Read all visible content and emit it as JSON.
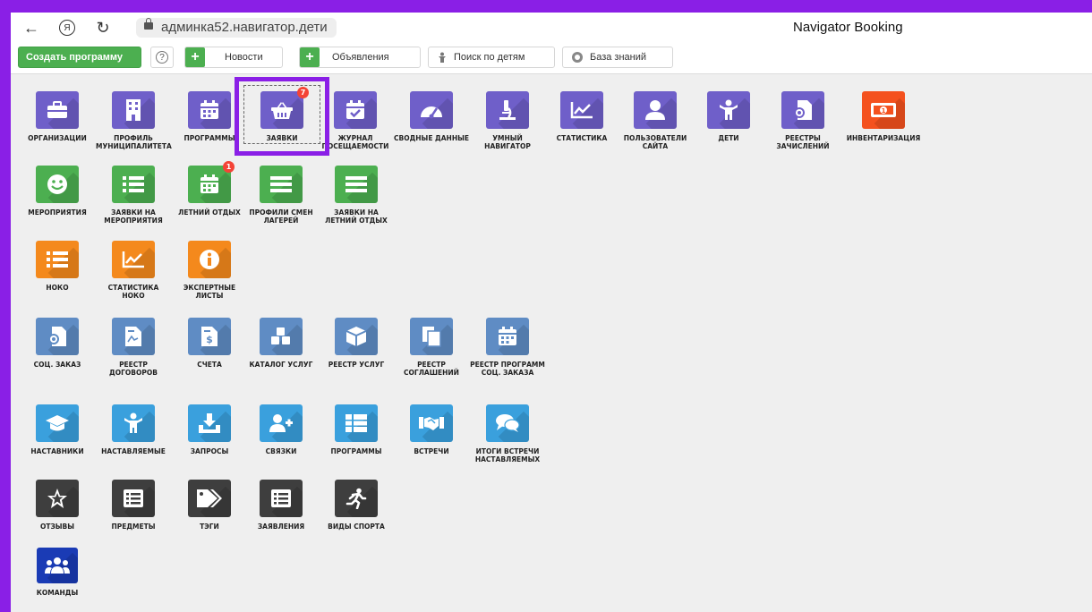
{
  "browser": {
    "back": "←",
    "yandex": "Я",
    "reload": "↻",
    "address": "админка52.навигатор.дети",
    "tab_title": "Navigator Booking"
  },
  "toolbar": {
    "create_program": "Создать программу",
    "help": "?",
    "news": "Новости",
    "ads": "Объявления",
    "search_children": "Поиск по детям",
    "knowledge_base": "База знаний",
    "plus": "+"
  },
  "tiles": {
    "org": "ОРГАНИЗАЦИИ",
    "profile_mun": "ПРОФИЛЬ МУНИЦИПАЛИТЕТА",
    "programs": "ПРОГРАММЫ",
    "requests": "ЗАЯВКИ",
    "requests_badge": "7",
    "journal": "ЖУРНАЛ ПОСЕЩАЕМОСТИ",
    "summary": "СВОДНЫЕ ДАННЫЕ",
    "smart_nav": "УМНЫЙ НАВИГАТОР",
    "statistics": "СТАТИСТИКА",
    "site_users": "ПОЛЬЗОВАТЕЛИ САЙТА",
    "children": "ДЕТИ",
    "enroll_registry": "РЕЕСТРЫ ЗАЧИСЛЕНИЙ",
    "inventory": "ИНВЕНТАРИЗАЦИЯ",
    "events": "МЕРОПРИЯТИЯ",
    "event_requests": "ЗАЯВКИ НА МЕРОПРИЯТИЯ",
    "summer": "ЛЕТНИЙ ОТДЫХ",
    "summer_badge": "1",
    "camp_profiles": "ПРОФИЛИ СМЕН ЛАГЕРЕЙ",
    "summer_requests": "ЗАЯВКИ НА ЛЕТНИЙ ОТДЫХ",
    "noko": "НОКО",
    "noko_stats": "СТАТИСТИКА НОКО",
    "expert_sheets": "ЭКСПЕРТНЫЕ ЛИСТЫ",
    "soc_order": "СОЦ. ЗАКАЗ",
    "contracts": "РЕЕСТР ДОГОВОРОВ",
    "invoices": "СЧЕТА",
    "service_catalog": "КАТАЛОГ УСЛУГ",
    "service_registry": "РЕЕСТР УСЛУГ",
    "agreements": "РЕЕСТР СОГЛАШЕНИЙ",
    "soc_programs": "РЕЕСТР ПРОГРАММ СОЦ. ЗАКАЗА",
    "mentors": "НАСТАВНИКИ",
    "mentees": "НАСТАВЛЯЕМЫЕ",
    "queries": "ЗАПРОСЫ",
    "links": "СВЯЗКИ",
    "mentor_programs": "ПРОГРАММЫ",
    "meetings": "ВСТРЕЧИ",
    "meeting_results": "ИТОГИ ВСТРЕЧИ НАСТАВЛЯЕМЫХ",
    "reviews": "ОТЗЫВЫ",
    "subjects": "ПРЕДМЕТЫ",
    "tags": "ТЭГИ",
    "applications": "ЗАЯВЛЕНИЯ",
    "sports": "ВИДЫ СПОРТА",
    "teams": "КОМАНДЫ"
  }
}
